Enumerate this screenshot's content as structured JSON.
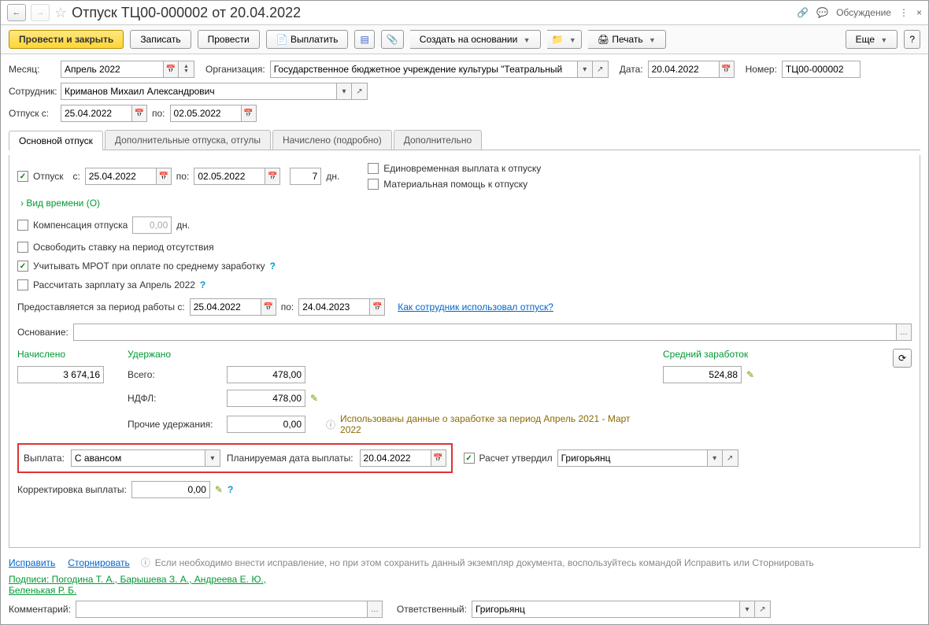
{
  "titlebar": {
    "title": "Отпуск ТЦ00-000002 от 20.04.2022",
    "discussion": "Обсуждение"
  },
  "toolbar": {
    "post_close": "Провести и закрыть",
    "save": "Записать",
    "post": "Провести",
    "pay": "Выплатить",
    "create_based": "Создать на основании",
    "print": "Печать",
    "more": "Еще"
  },
  "header": {
    "month_label": "Месяц:",
    "month_value": "Апрель 2022",
    "org_label": "Организация:",
    "org_value": "Государственное бюджетное учреждение культуры \"Театральный",
    "date_label": "Дата:",
    "date_value": "20.04.2022",
    "number_label": "Номер:",
    "number_value": "ТЦ00-000002",
    "employee_label": "Сотрудник:",
    "employee_value": "Криманов Михаил Александрович",
    "vacation_from_label": "Отпуск с:",
    "vacation_from": "25.04.2022",
    "to_label": "по:",
    "vacation_to": "02.05.2022"
  },
  "tabs": {
    "main": "Основной отпуск",
    "additional": "Дополнительные отпуска, отгулы",
    "accrued": "Начислено (подробно)",
    "extra": "Дополнительно"
  },
  "main_tab": {
    "vacation_label": "Отпуск",
    "from_label": "с:",
    "from_date": "25.04.2022",
    "to_label": "по:",
    "to_date": "02.05.2022",
    "days": "7",
    "days_label": "дн.",
    "lump_sum": "Единовременная выплата к отпуску",
    "material_aid": "Материальная помощь к отпуску",
    "time_type": "Вид времени (О)",
    "compensation_label": "Компенсация отпуска",
    "compensation_value": "0,00",
    "compensation_days": "дн.",
    "release_position": "Освободить ставку на период отсутствия",
    "mrot": "Учитывать МРОТ при оплате по среднему заработку",
    "calc_salary": "Рассчитать зарплату за Апрель 2022",
    "period_label": "Предоставляется за период работы с:",
    "period_from": "25.04.2022",
    "period_to_label": "по:",
    "period_to": "24.04.2023",
    "usage_link": "Как сотрудник использовал отпуск?",
    "basis_label": "Основание:"
  },
  "totals": {
    "accrued_label": "Начислено",
    "accrued_value": "3 674,16",
    "withheld_label": "Удержано",
    "total_label": "Всего:",
    "total_value": "478,00",
    "ndfl_label": "НДФЛ:",
    "ndfl_value": "478,00",
    "other_label": "Прочие удержания:",
    "other_value": "0,00",
    "avg_label": "Средний заработок",
    "avg_value": "524,88",
    "info_text": "Использованы данные о заработке за период Апрель 2021 - Март 2022"
  },
  "payment": {
    "payment_label": "Выплата:",
    "payment_value": "С авансом",
    "planned_date_label": "Планируемая дата выплаты:",
    "planned_date_value": "20.04.2022",
    "approved_label": "Расчет утвердил",
    "approved_by": "Григорьянц",
    "correction_label": "Корректировка выплаты:",
    "correction_value": "0,00"
  },
  "footer": {
    "fix_link": "Исправить",
    "reverse_link": "Сторнировать",
    "fix_hint": "Если необходимо внести исправление, но при этом сохранить данный экземпляр документа, воспользуйтесь командой Исправить или Сторнировать",
    "signatures": "Подписи: Погодина Т. А., Барышева З. А., Андреева Е. Ю., Беленькая Р. Б.",
    "comment_label": "Комментарий:",
    "responsible_label": "Ответственный:",
    "responsible_value": "Григорьянц"
  }
}
